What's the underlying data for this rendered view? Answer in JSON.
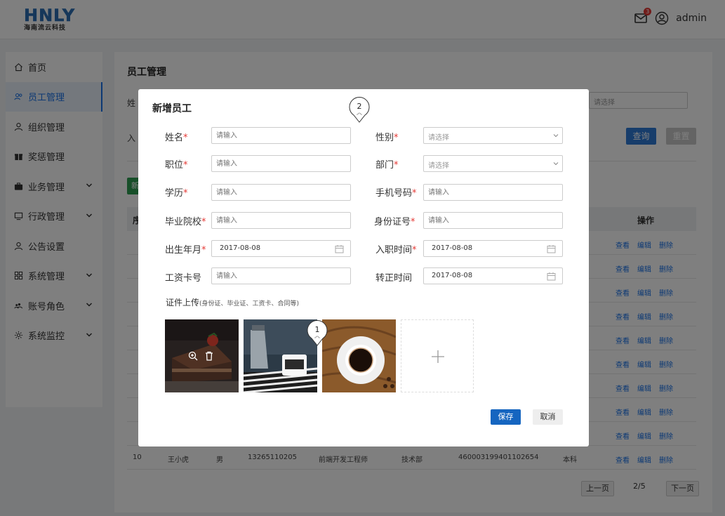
{
  "header": {
    "logo_text": "HNLY",
    "logo_subtitle": "海南流云科技",
    "mail_badge": "3",
    "username": "admin"
  },
  "sidebar": {
    "items": [
      {
        "label": "首页",
        "icon": "home-icon",
        "active": false,
        "expandable": false
      },
      {
        "label": "员工管理",
        "icon": "users-icon",
        "active": true,
        "expandable": false
      },
      {
        "label": "组织管理",
        "icon": "user-icon",
        "active": false,
        "expandable": false
      },
      {
        "label": "奖惩管理",
        "icon": "gift-icon",
        "active": false,
        "expandable": false
      },
      {
        "label": "业务管理",
        "icon": "briefcase-icon",
        "active": false,
        "expandable": true
      },
      {
        "label": "行政管理",
        "icon": "monitor-icon",
        "active": false,
        "expandable": true
      },
      {
        "label": "公告设置",
        "icon": "user-icon",
        "active": false,
        "expandable": false
      },
      {
        "label": "系统管理",
        "icon": "grid-icon",
        "active": false,
        "expandable": true
      },
      {
        "label": "账号角色",
        "icon": "group-icon",
        "active": false,
        "expandable": true
      },
      {
        "label": "系统监控",
        "icon": "sun-icon",
        "active": false,
        "expandable": true
      }
    ]
  },
  "main": {
    "title": "员工管理",
    "filter_label_1": "姓",
    "filter_label_2": "入",
    "filter_select_placeholder": "请选择",
    "query_label": "查询",
    "reset_label": "重置",
    "add_label": "新",
    "table": {
      "seq_header": "序",
      "ops_header": "操作",
      "op_view": "查看",
      "op_edit": "编辑",
      "op_delete": "删除",
      "last_row": {
        "seq": "10",
        "name": "王小虎",
        "gender": "男",
        "phone": "13265110205",
        "position": "前端开发工程师",
        "dept": "技术部",
        "id_no": "460003199401102654",
        "education": "本科"
      }
    },
    "pager": {
      "prev": "上一页",
      "page": "2/5",
      "next": "下一页"
    }
  },
  "modal": {
    "title": "新增员工",
    "fields": {
      "name": {
        "label": "姓名",
        "placeholder": "请输入"
      },
      "gender": {
        "label": "性别",
        "placeholder": "请选择"
      },
      "position": {
        "label": "职位",
        "placeholder": "请输入"
      },
      "department": {
        "label": "部门",
        "placeholder": "请选择"
      },
      "education": {
        "label": "学历",
        "placeholder": "请输入"
      },
      "phone": {
        "label": "手机号码",
        "placeholder": "请输入"
      },
      "school": {
        "label": "毕业院校",
        "placeholder": "请输入"
      },
      "id_card": {
        "label": "身份证号",
        "placeholder": "请输入"
      },
      "birth": {
        "label": "出生年月",
        "value": "2017-08-08"
      },
      "hire_date": {
        "label": "入职时间",
        "value": "2017-08-08"
      },
      "salary_card": {
        "label": "工资卡号",
        "placeholder": "请输入"
      },
      "regular_date": {
        "label": "转正时间",
        "value": "2017-08-08"
      }
    },
    "required_mark": "*",
    "upload_label": "证件上传",
    "upload_hint": "(身份证、毕业证、工资卡、合同等)",
    "save_label": "保存",
    "cancel_label": "取消"
  },
  "annotations": {
    "pin_1": "1",
    "pin_2": "2"
  },
  "colors": {
    "primary": "#1565c0",
    "query": "#2f7bd6",
    "add": "#2e9e52",
    "required": "#e53935",
    "link": "#1a73e8"
  }
}
